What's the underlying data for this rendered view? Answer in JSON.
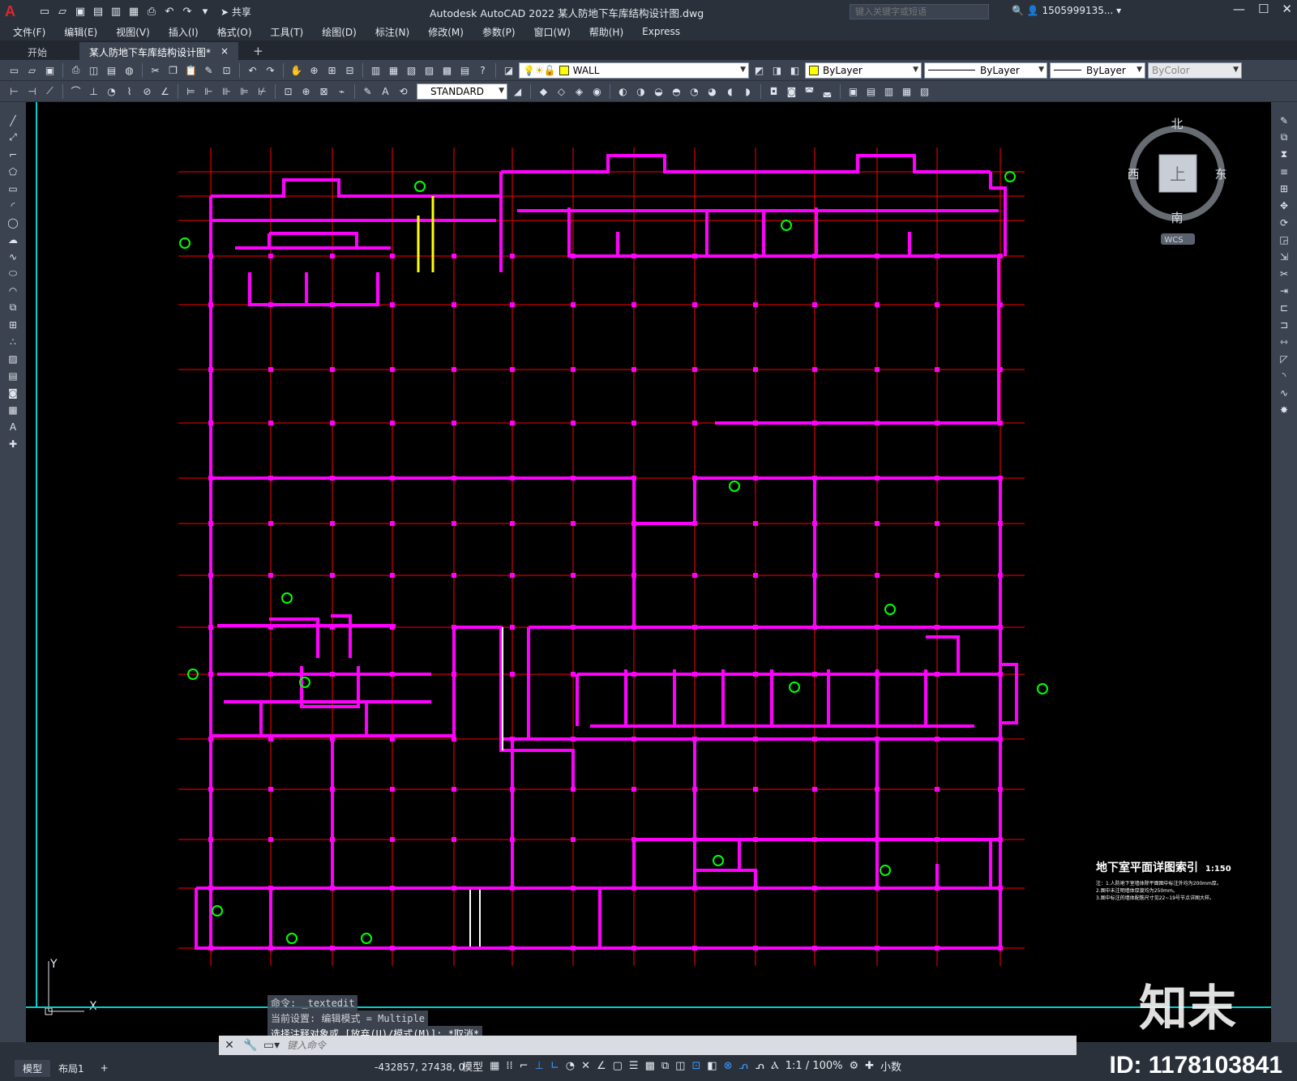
{
  "app": {
    "title": "Autodesk AutoCAD 2022    某人防地下车库结构设计图.dwg",
    "search_placeholder": "键入关键字或短语",
    "user": "1505999135... ▾",
    "share": "共享",
    "logo_letter": "A"
  },
  "menu": [
    "文件(F)",
    "编辑(E)",
    "视图(V)",
    "插入(I)",
    "格式(O)",
    "工具(T)",
    "绘图(D)",
    "标注(N)",
    "修改(M)",
    "参数(P)",
    "窗口(W)",
    "帮助(H)",
    "Express"
  ],
  "tabs": {
    "start": "开始",
    "active": "某人防地下车库结构设计图*",
    "close": "×",
    "add": "+"
  },
  "toolbar": {
    "layer": "WALL",
    "color": "ByLayer",
    "linetype": "ByLayer",
    "lineweight": "ByLayer",
    "plotstyle": "ByColor",
    "textstyle": "STANDARD"
  },
  "viewcube": {
    "north": "北",
    "south": "南",
    "east": "东",
    "west": "西",
    "top": "上",
    "wcs": "WCS"
  },
  "ucs": {
    "y": "Y",
    "x": "X"
  },
  "drawing": {
    "legend_title": "地下室平面详图索引",
    "legend_scale": "1:150",
    "legend_note1": "注：1.人防地下室墙体除平面图中标注外均为200mm厚。",
    "legend_note2": "2.图中未注明墙体厚度均为250mm。",
    "legend_note3": "3.图中标注的墙体配筋尺寸见22~19号节点详图大样。"
  },
  "command": {
    "line1": "命令: _textedit",
    "line2": "当前设置: 编辑模式 = Multiple",
    "line3": "选择注释对象或 [放弃(U)/模式(M)]: *取消*",
    "placeholder": "键入命令"
  },
  "status": {
    "model_tab": "模型",
    "layout_tab": "布局1",
    "add": "+",
    "coords": "-432857, 27438, 0",
    "model": "模型",
    "scale": "1:1 / 100%",
    "units": "小数"
  },
  "watermark": {
    "logo": "知末",
    "id": "ID: 1178103841"
  },
  "colors": {
    "wall": "#ff00ff",
    "grid": "#ff0000",
    "bg": "#000000",
    "ui": "#3b4350",
    "tag": "#00ff00"
  }
}
